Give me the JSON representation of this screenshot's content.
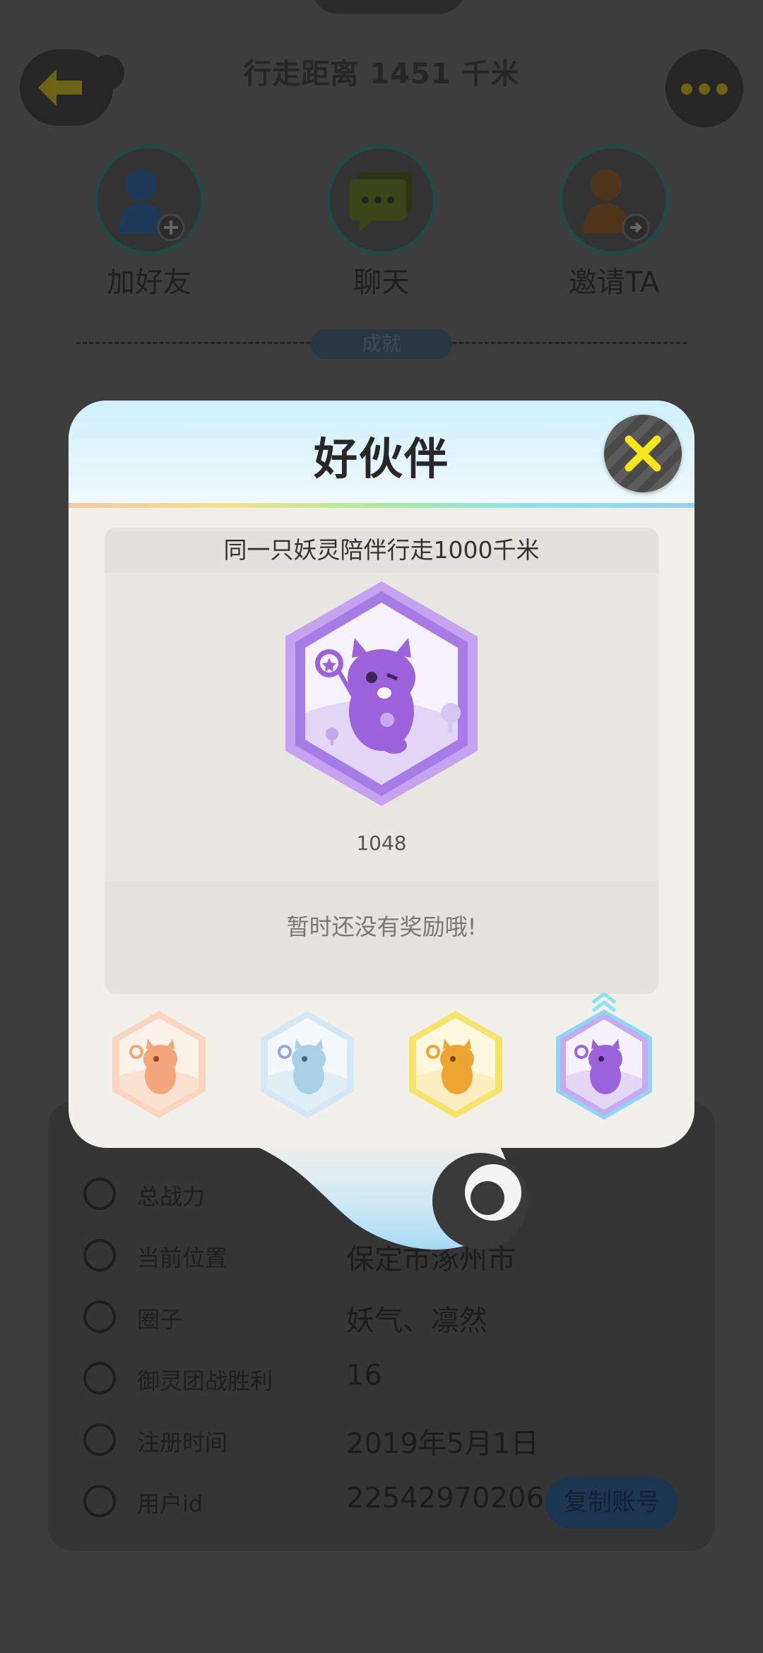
{
  "header": {
    "title": "行走距离 1451 千米"
  },
  "actions": [
    {
      "label": "加好友",
      "icon": "add-friend-icon",
      "color": "#2a5a86"
    },
    {
      "label": "聊天",
      "icon": "chat-icon",
      "color": "#5c6a22"
    },
    {
      "label": "邀请TA",
      "icon": "invite-icon",
      "color": "#8a5a22"
    }
  ],
  "achievements_label": "成就",
  "modal": {
    "title": "好伙伴",
    "description": "同一只妖灵陪伴行走1000千米",
    "badge_count": "1048",
    "reward_text": "暂时还没有奖励哦!",
    "tiers": [
      {
        "name": "bronze",
        "color": "#f2a679"
      },
      {
        "name": "silver",
        "color": "#a9d1e6"
      },
      {
        "name": "gold",
        "color": "#f1c232"
      },
      {
        "name": "purple",
        "color": "#9b6be0",
        "selected": true
      }
    ]
  },
  "info": {
    "rows": [
      {
        "key": "总战力",
        "value": "",
        "icon": "sword-icon"
      },
      {
        "key": "当前位置",
        "value": "保定市涿州市",
        "icon": "location-icon"
      },
      {
        "key": "圈子",
        "value": "妖气、凛然",
        "icon": "circle-icon"
      },
      {
        "key": "御灵团战胜利",
        "value": "16",
        "icon": "trophy-icon"
      },
      {
        "key": "注册时间",
        "value": "2019年5月1日",
        "icon": "clock-icon"
      },
      {
        "key": "用户id",
        "value": "22542970206",
        "icon": "id-icon"
      }
    ],
    "copy_label": "复制账号"
  }
}
